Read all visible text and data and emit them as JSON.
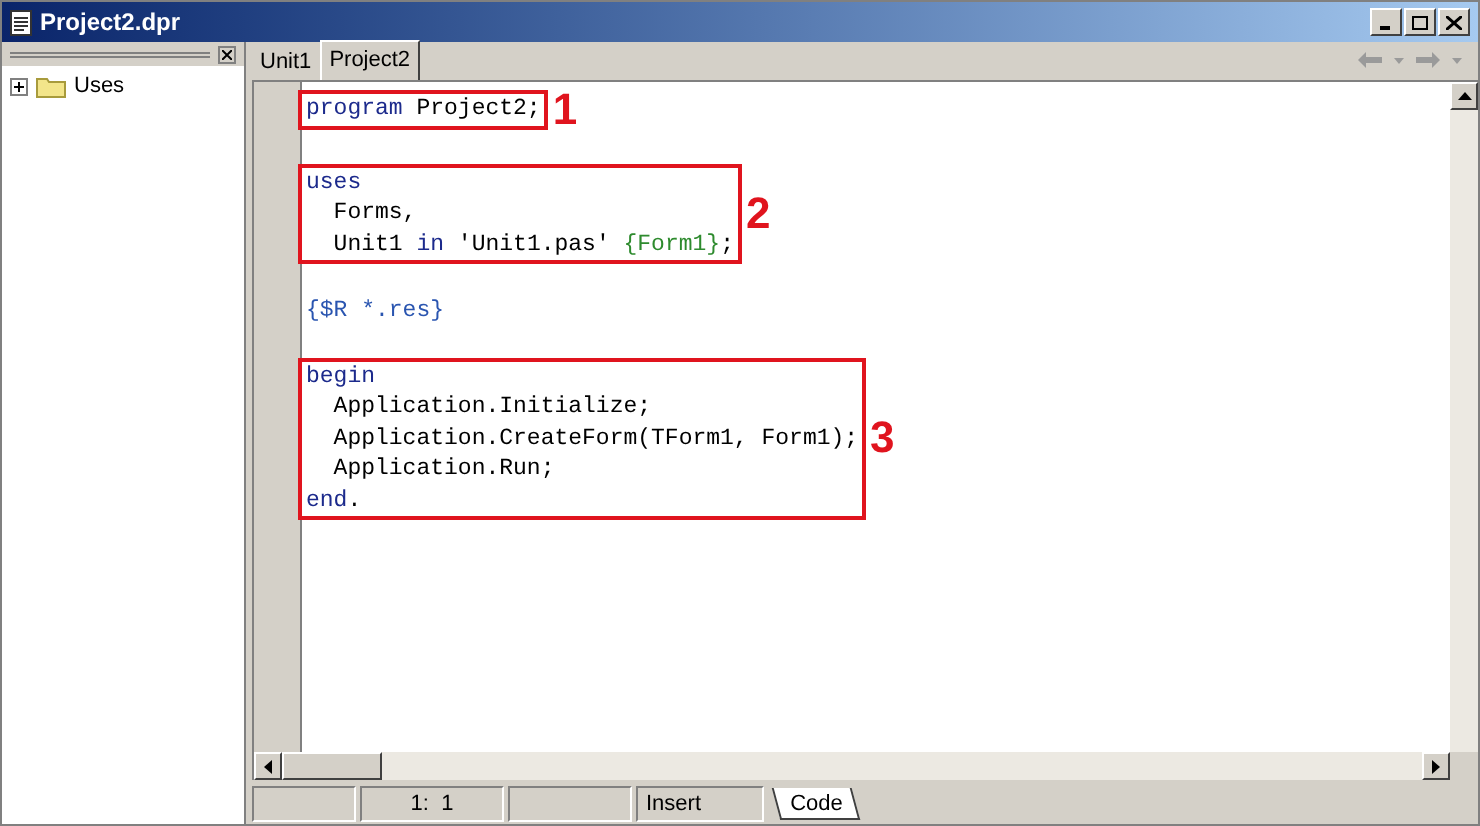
{
  "window": {
    "title": "Project2.dpr"
  },
  "explorer": {
    "items": [
      {
        "label": "Uses",
        "expanded": false
      }
    ]
  },
  "tabs": [
    {
      "label": "Unit1",
      "selected": false
    },
    {
      "label": "Project2",
      "selected": true
    }
  ],
  "code": {
    "blocks": [
      {
        "marker": "1",
        "lines": [
          {
            "tokens": [
              {
                "kind": "keyword",
                "text": "program"
              },
              {
                "kind": "plain",
                "text": " Project2;"
              }
            ]
          }
        ]
      },
      {
        "marker": "2",
        "lines": [
          {
            "tokens": [
              {
                "kind": "keyword",
                "text": "uses"
              }
            ]
          },
          {
            "tokens": [
              {
                "kind": "plain",
                "text": "  Forms,"
              }
            ]
          },
          {
            "tokens": [
              {
                "kind": "plain",
                "text": "  Unit1 "
              },
              {
                "kind": "keyword",
                "text": "in"
              },
              {
                "kind": "plain",
                "text": " 'Unit1.pas' "
              },
              {
                "kind": "comment",
                "text": "{Form1}"
              },
              {
                "kind": "plain",
                "text": ";"
              }
            ]
          }
        ]
      },
      {
        "lines": [
          {
            "tokens": [
              {
                "kind": "directive",
                "text": "{$R *.res}"
              }
            ]
          }
        ]
      },
      {
        "marker": "3",
        "lines": [
          {
            "tokens": [
              {
                "kind": "keyword",
                "text": "begin"
              }
            ]
          },
          {
            "tokens": [
              {
                "kind": "plain",
                "text": "  Application.Initialize;"
              }
            ]
          },
          {
            "tokens": [
              {
                "kind": "plain",
                "text": "  Application.CreateForm(TForm1, Form1);"
              }
            ]
          },
          {
            "tokens": [
              {
                "kind": "plain",
                "text": "  Application.Run;"
              }
            ]
          },
          {
            "tokens": [
              {
                "kind": "keyword",
                "text": "end"
              },
              {
                "kind": "plain",
                "text": "."
              }
            ]
          }
        ]
      }
    ]
  },
  "status_bar": {
    "position": "1:  1",
    "mode": "Insert"
  },
  "view_tabs": [
    {
      "label": "Code",
      "selected": true
    }
  ]
}
